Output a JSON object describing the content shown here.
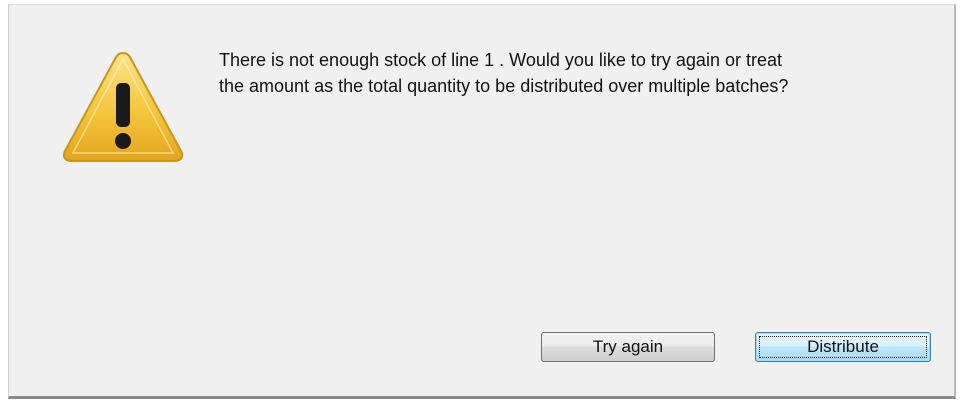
{
  "dialog": {
    "icon": "warning-triangle-icon",
    "icon_colors": {
      "triangle_fill": "#f5c53b",
      "triangle_edge": "#c8961b",
      "glyph": "#1a1a1a"
    },
    "message": "There is not enough stock of line 1 . Would you like to try again or treat\nthe amount as the total quantity to be distributed over multiple batches?",
    "buttons": {
      "try_again_label": "Try again",
      "distribute_label": "Distribute"
    },
    "default_button": "Distribute",
    "accent_color": "#3c7fb1"
  }
}
